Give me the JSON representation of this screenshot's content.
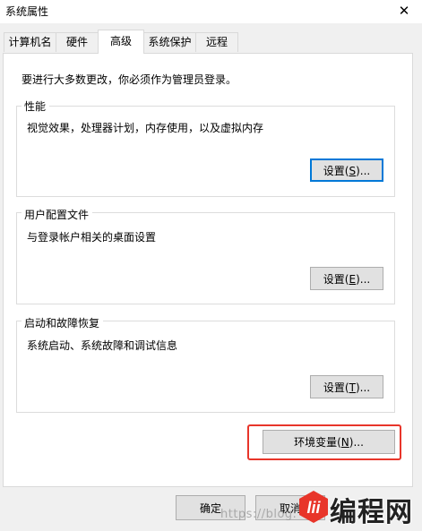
{
  "window": {
    "title": "系统属性",
    "close_glyph": "✕"
  },
  "tabs": [
    {
      "label": "计算机名",
      "active": false
    },
    {
      "label": "硬件",
      "active": false
    },
    {
      "label": "高级",
      "active": true
    },
    {
      "label": "系统保护",
      "active": false
    },
    {
      "label": "远程",
      "active": false
    }
  ],
  "advanced": {
    "admin_notice": "要进行大多数更改，你必须作为管理员登录。",
    "performance": {
      "legend": "性能",
      "description": "视觉效果，处理器计划，内存使用，以及虚拟内存",
      "button": "设置(S)..."
    },
    "user_profiles": {
      "legend": "用户配置文件",
      "description": "与登录帐户相关的桌面设置",
      "button": "设置(E)..."
    },
    "startup_recovery": {
      "legend": "启动和故障恢复",
      "description": "系统启动、系统故障和调试信息",
      "button": "设置(T)..."
    },
    "env_button": "环境变量(N)...",
    "highlight_color": "#e8352a"
  },
  "footer": {
    "ok_label": "确定",
    "cancel_label": "取消"
  },
  "watermark": {
    "url_text": "https://blog.",
    "logo_glyph": "lii",
    "site_name": "编程网"
  },
  "colors": {
    "dialog_bg": "#f0f0f0",
    "panel_bg": "#ffffff",
    "button_bg": "#e1e1e1",
    "button_border": "#adadad",
    "focus_border": "#0078d7",
    "logo_red": "#e8352a"
  }
}
